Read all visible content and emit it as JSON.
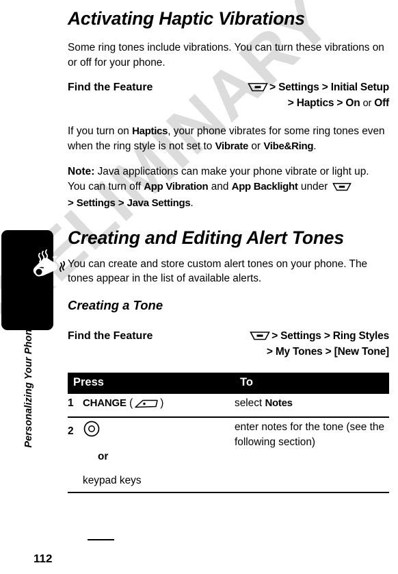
{
  "document": {
    "page_number": "112",
    "running_head": "Personalizing Your Phone",
    "watermark": "PRELIMINARY",
    "side_tab_icon": "ringing-bell-icon"
  },
  "section_haptic": {
    "title": "Activating Haptic Vibrations",
    "intro": "Some ring tones include vibrations. You can turn these vibrations on or off for your phone.",
    "find_the_feature": {
      "label": "Find the Feature",
      "menu_icon": "menu-key-icon",
      "line1_sep1": ">",
      "line1_item1": "Settings",
      "line1_sep2": ">",
      "line1_item2": "Initial Setup",
      "line2_sep1": ">",
      "line2_item1": "Haptics",
      "line2_sep2": ">",
      "line2_item2": "On",
      "line2_conj": "or",
      "line2_item3": "Off"
    },
    "para1_a": "If you turn on ",
    "para1_ui1": "Haptics",
    "para1_b": ", your phone vibrates for some ring tones even when the ring style is not set to ",
    "para1_ui2": "Vibrate",
    "para1_c": " or ",
    "para1_ui3": "Vibe&Ring",
    "para1_d": ".",
    "note_label": "Note:",
    "note_a": " Java applications can make your phone vibrate or light up. You can turn off ",
    "note_ui1": "App Vibration",
    "note_b": " and ",
    "note_ui2": "App Backlight",
    "note_c": " under ",
    "note_icon": "menu-key-icon",
    "note_sep1": ">",
    "note_ui3": "Settings",
    "note_sep2": ">",
    "note_ui4": "Java Settings",
    "note_d": "."
  },
  "section_alert_tones": {
    "title": "Creating and Editing Alert Tones",
    "intro": "You can create and store custom alert tones on your phone. The tones appear in the list of available alerts.",
    "subsection": {
      "title": "Creating a Tone",
      "find_the_feature": {
        "label": "Find the Feature",
        "menu_icon": "menu-key-icon",
        "line1_sep1": ">",
        "line1_item1": "Settings",
        "line1_sep2": ">",
        "line1_item2": "Ring Styles",
        "line2_sep1": ">",
        "line2_item1": "My Tones",
        "line2_sep2": ">",
        "line2_item2": "[New Tone]"
      },
      "table": {
        "headers": {
          "press": "Press",
          "to": "To"
        },
        "rows": [
          {
            "num": "1",
            "key_label": "CHANGE",
            "key_icon": "soft-key-icon",
            "open_paren": "(",
            "close_paren": ")",
            "to_prefix": "select ",
            "to_ui": "Notes",
            "to_suffix": ""
          },
          {
            "num": "2",
            "key_label": "",
            "key_icon": "center-select-key-icon",
            "or_word": "or",
            "alt_key": "keypad keys",
            "to_prefix": "enter notes for the tone (see the following section)",
            "to_ui": "",
            "to_suffix": ""
          }
        ]
      }
    }
  },
  "colors": {
    "text": "#000000",
    "background": "#ffffff",
    "table_header_bg": "#000000",
    "table_header_fg": "#ffffff",
    "watermark": "#dcdcdc",
    "tab": "#000000"
  }
}
